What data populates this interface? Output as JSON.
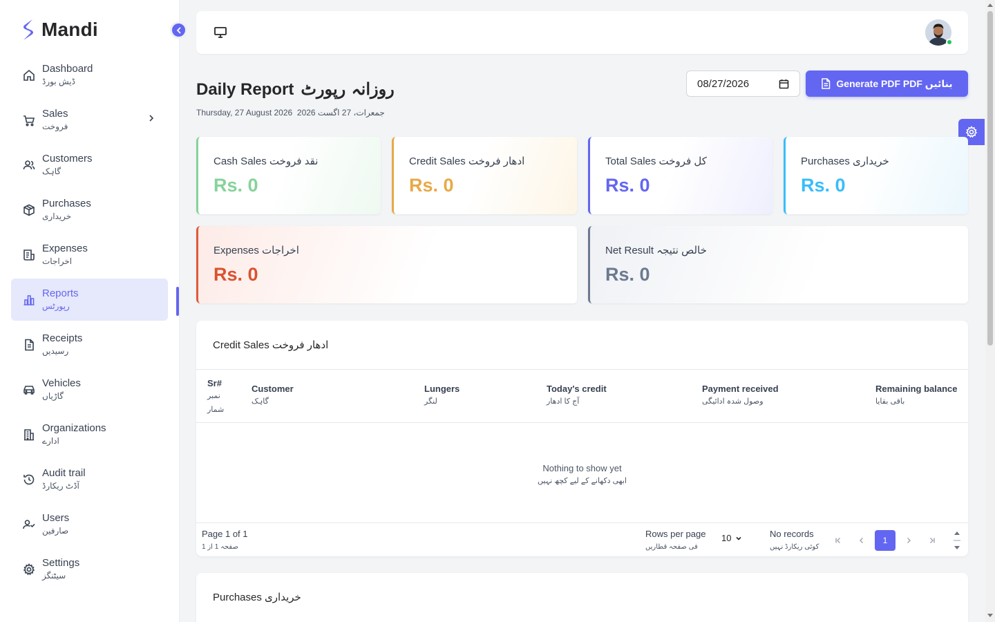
{
  "app": {
    "name": "Mandi"
  },
  "sidebar": {
    "items": [
      {
        "en": "Dashboard",
        "ur": "ڈیش بورڈ",
        "icon": "home-icon"
      },
      {
        "en": "Sales",
        "ur": "فروخت",
        "icon": "cart-icon"
      },
      {
        "en": "Customers",
        "ur": "گاہک",
        "icon": "users-icon"
      },
      {
        "en": "Purchases",
        "ur": "خریداری",
        "icon": "box-icon"
      },
      {
        "en": "Expenses",
        "ur": "اخراجات",
        "icon": "receipt-icon"
      },
      {
        "en": "Reports",
        "ur": "رپورٹس",
        "icon": "bar-chart-icon"
      },
      {
        "en": "Receipts",
        "ur": "رسیدیں",
        "icon": "document-icon"
      },
      {
        "en": "Vehicles",
        "ur": "گاڑیاں",
        "icon": "car-icon"
      },
      {
        "en": "Organizations",
        "ur": "ادارے",
        "icon": "building-icon"
      },
      {
        "en": "Audit trail",
        "ur": "آڈٹ ریکارڈ",
        "icon": "history-icon"
      },
      {
        "en": "Users",
        "ur": "صارفین",
        "icon": "user-check-icon"
      },
      {
        "en": "Settings",
        "ur": "سیٹنگز",
        "icon": "gear-icon"
      }
    ],
    "active": "Reports"
  },
  "header": {
    "title_en": "Daily Report",
    "title_ur": "روزانہ رپورٹ",
    "date_en": "Thursday, 27 August 2026",
    "date_ur": "جمعرات، 27 اگست 2026",
    "date_value": "08/27/2026",
    "pdf_label": "Generate PDF  PDF بنائیں"
  },
  "cards": {
    "cash": {
      "label": "Cash Sales  نقد فروخت",
      "value": "Rs. 0",
      "color": "#86d39a"
    },
    "credit": {
      "label": "Credit Sales  ادھار فروخت",
      "value": "Rs. 0",
      "color": "#e8a947"
    },
    "total": {
      "label": "Total Sales  کل فروخت",
      "value": "Rs. 0",
      "color": "#6366f1"
    },
    "purchases": {
      "label": "Purchases  خریداری",
      "value": "Rs. 0",
      "color": "#38bdf8"
    },
    "expenses": {
      "label": "Expenses  اخراجات",
      "value": "Rs. 0",
      "color": "#e05a3a"
    },
    "net": {
      "label": "Net Result  خالص نتیجہ",
      "value": "Rs. 0",
      "color": "#6b7a90"
    }
  },
  "credit_table": {
    "title": "Credit Sales  ادھار فروخت",
    "columns": [
      {
        "en": "Sr#",
        "ur": "نمبر شمار"
      },
      {
        "en": "Customer",
        "ur": "گاہک"
      },
      {
        "en": "Lungers",
        "ur": "لنگر"
      },
      {
        "en": "Today's credit",
        "ur": "آج کا ادھار"
      },
      {
        "en": "Payment received",
        "ur": "وصول شدہ ادائیگی"
      },
      {
        "en": "Remaining balance",
        "ur": "باقی بقایا"
      }
    ],
    "empty_en": "Nothing to show yet",
    "empty_ur": "ابھی دکھانے کے لیے کچھ نہیں",
    "pager": {
      "page_en": "Page 1 of 1",
      "page_ur": "صفحہ 1 از 1",
      "rows_en": "Rows per page",
      "rows_ur": "فی صفحہ قطاریں",
      "rows_value": "10",
      "records_en": "No records",
      "records_ur": "کوئی ریکارڈ نہیں",
      "current": "1"
    }
  },
  "purchases_table": {
    "title": "Purchases  خریداری"
  }
}
